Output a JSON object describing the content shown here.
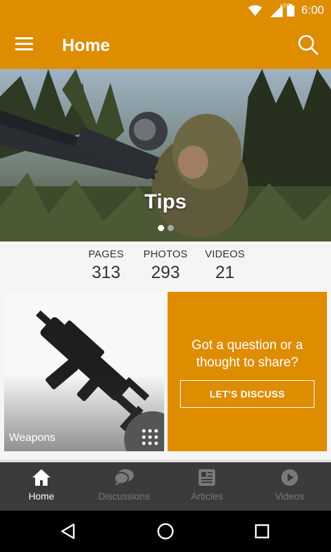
{
  "status_bar": {
    "time": "6:00",
    "network": "LTE"
  },
  "app_bar": {
    "title": "Home"
  },
  "hero": {
    "title": "Tips",
    "slide_count": 2,
    "active_slide": 0
  },
  "stats": [
    {
      "label": "PAGES",
      "value": "313"
    },
    {
      "label": "PHOTOS",
      "value": "293"
    },
    {
      "label": "VIDEOS",
      "value": "21"
    }
  ],
  "weapons_card": {
    "label": "Weapons"
  },
  "discuss_card": {
    "text": "Got a question or a thought to share?",
    "button": "LET'S DISCUSS"
  },
  "bottom_nav": [
    {
      "label": "Home",
      "icon": "home-icon",
      "active": true
    },
    {
      "label": "Discussions",
      "icon": "chat-icon",
      "active": false
    },
    {
      "label": "Articles",
      "icon": "article-icon",
      "active": false
    },
    {
      "label": "Videos",
      "icon": "play-icon",
      "active": false
    }
  ],
  "colors": {
    "accent": "#de8c00",
    "nav_bg": "#3b3b3b"
  }
}
